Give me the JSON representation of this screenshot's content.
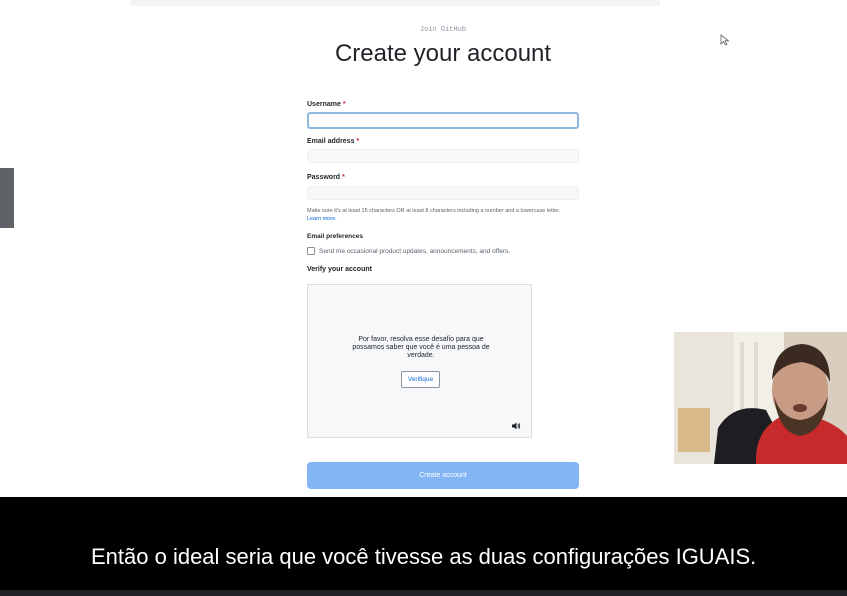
{
  "page": {
    "eyebrow": "Join GitHub",
    "title": "Create your account"
  },
  "form": {
    "username_label": "Username",
    "email_label": "Email address",
    "password_label": "Password",
    "required_mark": "*",
    "username_value": "",
    "email_value": "",
    "password_value": "",
    "password_hint": "Make sure it's at least 15 characters OR at least 8 characters including a number and a lowercase letter.",
    "learn_more": "Learn more.",
    "prefs_heading": "Email preferences",
    "prefs_checkbox_label": "Send me occasional product updates, announcements, and offers.",
    "verify_heading": "Verify your account",
    "create_button": "Create account"
  },
  "captcha": {
    "message": "Por favor, resolva esse desafio para que possamos saber que você é uma pessoa de verdade.",
    "button": "Verifique"
  },
  "caption": {
    "text": "Então o ideal seria que você tivesse as duas configurações IGUAIS."
  },
  "colors": {
    "button_disabled": "#83b5f5",
    "link": "#0969da",
    "caption_bg": "#000000"
  }
}
